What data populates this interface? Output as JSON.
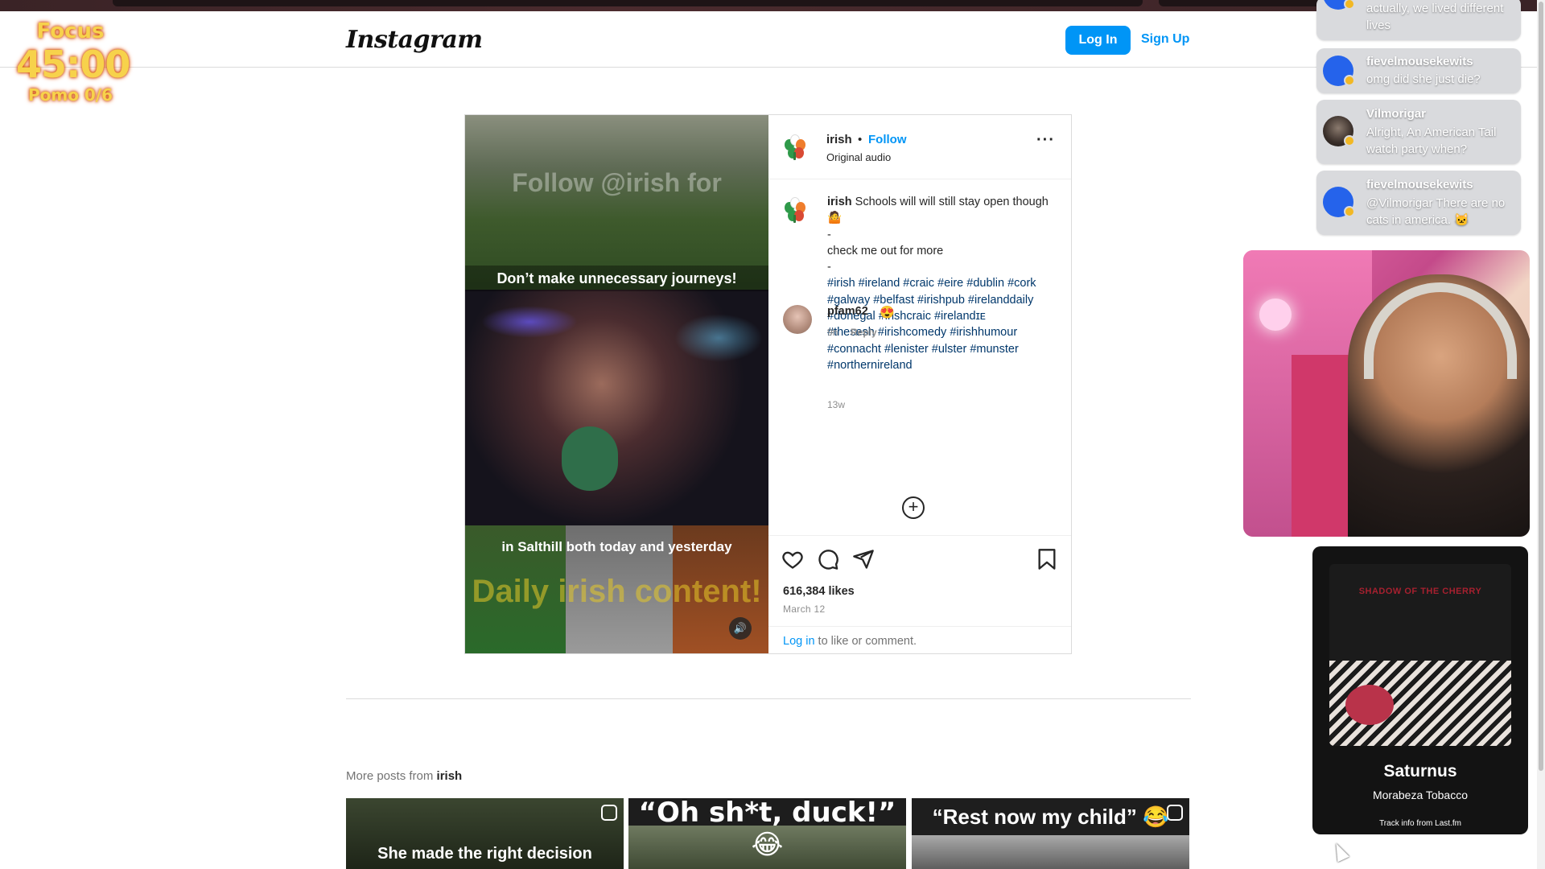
{
  "header": {
    "logo": "Instagram",
    "login_label": "Log In",
    "signup_label": "Sign Up"
  },
  "focus": {
    "label": "Focus",
    "time": "45:00",
    "pomo": "Pomo 0/6"
  },
  "post": {
    "username": "irish",
    "follow_label": "Follow",
    "audio": "Original audio",
    "media": {
      "overlay_watermark": "Follow @irish for",
      "caption_top": "Don’t make unnecessary journeys!",
      "caption_bottom": "in Salthill both today and yesterday",
      "overlay_daily": "Daily irish content!"
    },
    "caption": {
      "username": "irish",
      "text": "Schools will will still stay open though 🤷",
      "dash1": "-",
      "line2": "check me out for more",
      "dash2": "-",
      "hashtags_1": "#irish #ireland #craic #eire #dublin #cork #galway #belfast #irishpub #irelanddaily #donegal #irishcraic #irelandɪᴇ",
      "hashtags_2": "#thesesh #irishcomedy #irishhumour #connacht #lenister #ulster #munster #northernireland",
      "time": "13w"
    },
    "comment": {
      "username": "pfam62",
      "emoji": "😍",
      "time": "9h",
      "reply_label": "Reply"
    },
    "likes": "616,384 likes",
    "date": "March 12",
    "login_link": "Log in",
    "login_suffix": " to like or comment."
  },
  "more_posts": {
    "prefix": "More posts from ",
    "user": "irish",
    "thumbs": [
      {
        "caption": "She made the right decision"
      },
      {
        "caption": "“Oh sh*t, duck!” 😂"
      },
      {
        "caption": "“Rest now my child” 😂"
      }
    ]
  },
  "chat": {
    "messages": [
      {
        "user": "",
        "text": "actually, we lived different lives"
      },
      {
        "user": "fievelmousekewits",
        "text": "omg did she just die?"
      },
      {
        "user": "Vilmorigar",
        "text": "Alright, An American Tail watch party when?"
      },
      {
        "user": "fievelmousekewits",
        "text": "@Vilmorigar There are no cats in america. 🐱"
      }
    ]
  },
  "music": {
    "album_text": "SHADOW OF THE CHERRY",
    "track": "Saturnus",
    "artist": "Morabeza Tobacco",
    "source": "Track info from Last.fm"
  },
  "colors": {
    "accent": "#0095f6",
    "focus_text": "#f7d24b"
  }
}
